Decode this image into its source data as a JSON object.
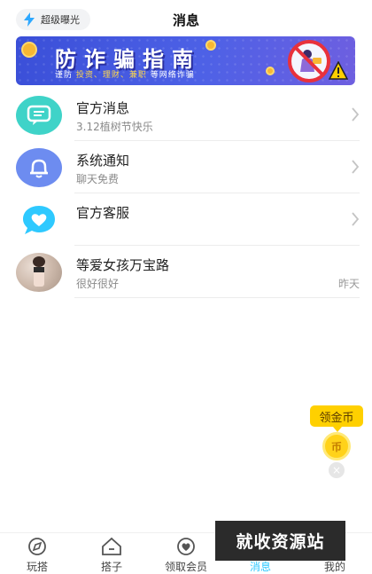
{
  "header": {
    "boost_label": "超级曝光",
    "title": "消息"
  },
  "banner": {
    "title": "防诈骗指南",
    "subtitle_prefix": "谨防 ",
    "subtitle_highlight": "投资、理财、兼职",
    "subtitle_suffix": " 等网络诈骗"
  },
  "messages": [
    {
      "name": "官方消息",
      "preview": "3.12植树节快乐",
      "time": "",
      "icon": "chat-bubble-icon",
      "icon_color": "#3fd3c8"
    },
    {
      "name": "系统通知",
      "preview": "聊天免费",
      "time": "",
      "icon": "bell-icon",
      "icon_color": "#6d8cf0"
    },
    {
      "name": "官方客服",
      "preview": "",
      "time": "",
      "icon": "heart-chat-icon",
      "icon_color": "#2ec9ff"
    },
    {
      "name": "等爱女孩万宝路",
      "preview": "很好很好",
      "time": "昨天",
      "icon": "user-photo",
      "icon_color": ""
    }
  ],
  "gold": {
    "label": "领金币",
    "coin_glyph": "币",
    "close_glyph": "×"
  },
  "tabs": [
    {
      "label": "玩搭",
      "icon": "compass-icon",
      "active": false
    },
    {
      "label": "搭子",
      "icon": "home-icon",
      "active": false
    },
    {
      "label": "领取会员",
      "icon": "vip-heart-icon",
      "active": false
    },
    {
      "label": "消息",
      "icon": "message-icon",
      "active": true
    },
    {
      "label": "我的",
      "icon": "profile-icon",
      "active": false
    }
  ],
  "watermark": "就收资源站",
  "colors": {
    "accent": "#2ec9ff",
    "banner": "#4357e0",
    "gold": "#ffd000"
  }
}
